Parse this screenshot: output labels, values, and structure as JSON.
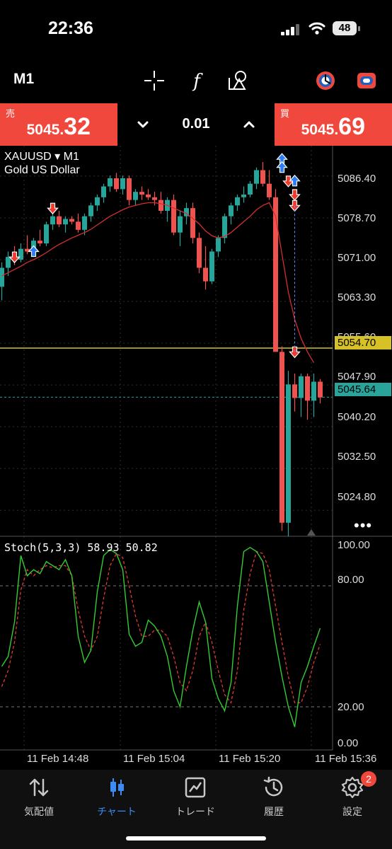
{
  "status_bar": {
    "time": "22:36",
    "battery": "48"
  },
  "toolbar": {
    "timeframe": "M1",
    "tools": [
      "crosshair-icon",
      "function-icon",
      "objects-icon",
      "indicator-settings-icon",
      "trade-toggle-icon"
    ]
  },
  "trade_panel": {
    "sell_label": "売",
    "sell_price_small": "5045.",
    "sell_price_big": "32",
    "buy_label": "買",
    "buy_price_small": "5045.",
    "buy_price_big": "69",
    "lot": "0.01",
    "colors": {
      "sell": "#f0483c",
      "buy": "#f0483c"
    }
  },
  "chart": {
    "symbol": "XAUUSD",
    "symbol_arrow": "▾",
    "timeframe": "M1",
    "description": "Gold US Dollar",
    "price_labels": [
      "5086.40",
      "5078.70",
      "5071.00",
      "5063.30",
      "5055.60",
      "5047.90",
      "5040.20",
      "5032.50",
      "5024.80"
    ],
    "level_gold": "5054.70",
    "level_bid": "5045.64",
    "more": "•••",
    "stoch_label": "Stoch(5,3,3) 58.93 50.82",
    "stoch_labels": [
      "100.00",
      "80.00",
      "20.00",
      "0.00"
    ],
    "date_labels": [
      "11 Feb 14:48",
      "11 Feb 15:04",
      "11 Feb 15:20",
      "11 Feb 15:36"
    ],
    "colors": {
      "bull": "#26a69a",
      "bear": "#ef5350",
      "ma": "#d32f2f",
      "gold_line": "#d6c227",
      "bid_line": "#2aa39a",
      "stoch_main": "#33cc33",
      "stoch_signal": "#e53935"
    }
  },
  "chart_data": {
    "type": "candlestick",
    "symbol": "XAUUSD",
    "timeframe": "M1",
    "ylim": [
      5020.0,
      5092.0
    ],
    "candles": [
      [
        5066.0,
        5070.5,
        5063.5,
        5069.5
      ],
      [
        5069.5,
        5072.5,
        5068.0,
        5071.5
      ],
      [
        5071.5,
        5073.5,
        5070.0,
        5071.0
      ],
      [
        5071.0,
        5074.0,
        5070.5,
        5073.0
      ],
      [
        5073.0,
        5075.5,
        5072.0,
        5072.5
      ],
      [
        5072.5,
        5075.0,
        5071.5,
        5074.5
      ],
      [
        5074.5,
        5076.5,
        5073.5,
        5074.0
      ],
      [
        5074.0,
        5078.0,
        5073.5,
        5077.5
      ],
      [
        5077.5,
        5079.5,
        5076.5,
        5079.0
      ],
      [
        5079.0,
        5080.0,
        5077.0,
        5077.5
      ],
      [
        5077.5,
        5079.0,
        5076.0,
        5078.5
      ],
      [
        5078.5,
        5079.0,
        5077.5,
        5078.0
      ],
      [
        5078.0,
        5079.5,
        5076.0,
        5076.5
      ],
      [
        5076.5,
        5079.5,
        5075.5,
        5079.0
      ],
      [
        5079.0,
        5081.5,
        5078.0,
        5081.0
      ],
      [
        5081.0,
        5083.0,
        5080.0,
        5082.5
      ],
      [
        5082.5,
        5085.0,
        5081.5,
        5084.5
      ],
      [
        5084.5,
        5086.5,
        5083.5,
        5086.0
      ],
      [
        5086.0,
        5087.0,
        5083.5,
        5084.0
      ],
      [
        5084.0,
        5086.5,
        5083.0,
        5086.0
      ],
      [
        5086.0,
        5086.5,
        5081.0,
        5082.0
      ],
      [
        5082.0,
        5084.0,
        5081.0,
        5083.5
      ],
      [
        5083.5,
        5084.5,
        5082.0,
        5083.0
      ],
      [
        5083.0,
        5084.0,
        5082.0,
        5082.5
      ],
      [
        5082.5,
        5083.5,
        5081.0,
        5082.0
      ],
      [
        5082.0,
        5083.5,
        5079.5,
        5080.0
      ],
      [
        5080.0,
        5082.5,
        5078.0,
        5082.0
      ],
      [
        5082.0,
        5083.0,
        5075.5,
        5076.0
      ],
      [
        5076.0,
        5080.0,
        5073.5,
        5079.0
      ],
      [
        5079.0,
        5081.5,
        5077.5,
        5080.5
      ],
      [
        5080.5,
        5081.5,
        5074.0,
        5075.0
      ],
      [
        5075.0,
        5076.0,
        5068.5,
        5069.5
      ],
      [
        5069.5,
        5073.5,
        5065.5,
        5067.0
      ],
      [
        5067.0,
        5073.0,
        5066.5,
        5072.5
      ],
      [
        5072.5,
        5075.5,
        5071.5,
        5075.0
      ],
      [
        5075.0,
        5079.5,
        5074.0,
        5079.0
      ],
      [
        5079.0,
        5081.5,
        5077.5,
        5081.0
      ],
      [
        5081.0,
        5083.0,
        5080.0,
        5082.5
      ],
      [
        5082.5,
        5084.5,
        5081.5,
        5083.0
      ],
      [
        5083.0,
        5085.5,
        5082.5,
        5085.0
      ],
      [
        5085.0,
        5088.0,
        5084.0,
        5087.5
      ],
      [
        5087.5,
        5089.0,
        5084.5,
        5085.0
      ],
      [
        5085.0,
        5087.5,
        5082.0,
        5082.5
      ],
      [
        5082.5,
        5084.0,
        5075.0,
        5054.0
      ],
      [
        5054.0,
        5055.0,
        5021.0,
        5022.5
      ],
      [
        5022.5,
        5050.5,
        5020.0,
        5048.0
      ],
      [
        5048.0,
        5050.0,
        5043.0,
        5045.5
      ],
      [
        5045.5,
        5050.0,
        5042.0,
        5049.5
      ],
      [
        5049.5,
        5050.0,
        5041.5,
        5045.0
      ],
      [
        5045.0,
        5050.0,
        5042.0,
        5048.5
      ],
      [
        5048.5,
        5049.0,
        5044.5,
        5045.6
      ]
    ],
    "moving_average": [
      5068.0,
      5068.6,
      5069.2,
      5069.8,
      5070.5,
      5071.0,
      5071.6,
      5072.3,
      5073.1,
      5073.8,
      5074.4,
      5075.0,
      5075.5,
      5076.0,
      5076.6,
      5077.4,
      5078.2,
      5079.0,
      5079.6,
      5080.2,
      5080.7,
      5081.0,
      5081.3,
      5081.5,
      5081.5,
      5081.3,
      5081.0,
      5080.5,
      5080.0,
      5079.5,
      5078.6,
      5077.6,
      5076.3,
      5075.4,
      5075.0,
      5075.3,
      5076.0,
      5077.0,
      5078.0,
      5079.0,
      5080.2,
      5081.0,
      5081.5,
      5079.0,
      5072.0,
      5065.0,
      5060.0,
      5056.5,
      5054.0,
      5052.0
    ],
    "levels": {
      "gold": 5054.7,
      "bid": 5045.64
    },
    "stochastic": {
      "params": "Stoch(5,3,3)",
      "main_last": 58.93,
      "signal_last": 50.82,
      "main": [
        40,
        45,
        62,
        95,
        85,
        88,
        86,
        92,
        90,
        88,
        93,
        85,
        55,
        42,
        48,
        77,
        95,
        98,
        96,
        88,
        56,
        50,
        52,
        63,
        60,
        55,
        45,
        28,
        20,
        40,
        58,
        72,
        62,
        34,
        24,
        18,
        32,
        70,
        97,
        99,
        97,
        92,
        72,
        52,
        35,
        20,
        10,
        32,
        40,
        50,
        59
      ],
      "signal": [
        30,
        38,
        52,
        78,
        88,
        85,
        88,
        90,
        89,
        90,
        90,
        85,
        68,
        55,
        48,
        55,
        74,
        90,
        96,
        94,
        80,
        65,
        55,
        55,
        58,
        58,
        55,
        45,
        32,
        28,
        38,
        55,
        62,
        52,
        38,
        26,
        22,
        38,
        68,
        86,
        97,
        96,
        88,
        70,
        52,
        35,
        22,
        22,
        30,
        42,
        51
      ]
    },
    "marks": [
      {
        "type": "sell",
        "index": 2,
        "price": 5071.5
      },
      {
        "type": "buy",
        "index": 5,
        "price": 5072.5
      },
      {
        "type": "sell",
        "index": 8,
        "price": 5080.5
      },
      {
        "type": "buy",
        "index": 44,
        "price": 5089.5
      },
      {
        "type": "buy",
        "index": 44,
        "price": 5088.0
      },
      {
        "type": "sell",
        "index": 45,
        "price": 5085.5
      },
      {
        "type": "buy",
        "index": 46,
        "price": 5085.5
      },
      {
        "type": "sell",
        "index": 46,
        "price": 5083.0
      },
      {
        "type": "sell",
        "index": 46,
        "price": 5081.0
      },
      {
        "type": "sell",
        "index": 46,
        "price": 5054.0
      }
    ]
  },
  "nav": {
    "items": [
      {
        "label": "気配値",
        "icon": "quotes-icon"
      },
      {
        "label": "チャート",
        "icon": "chart-icon"
      },
      {
        "label": "トレード",
        "icon": "trade-icon"
      },
      {
        "label": "履歴",
        "icon": "history-icon"
      },
      {
        "label": "設定",
        "icon": "settings-icon"
      }
    ],
    "active_index": 1,
    "settings_badge": "2"
  }
}
